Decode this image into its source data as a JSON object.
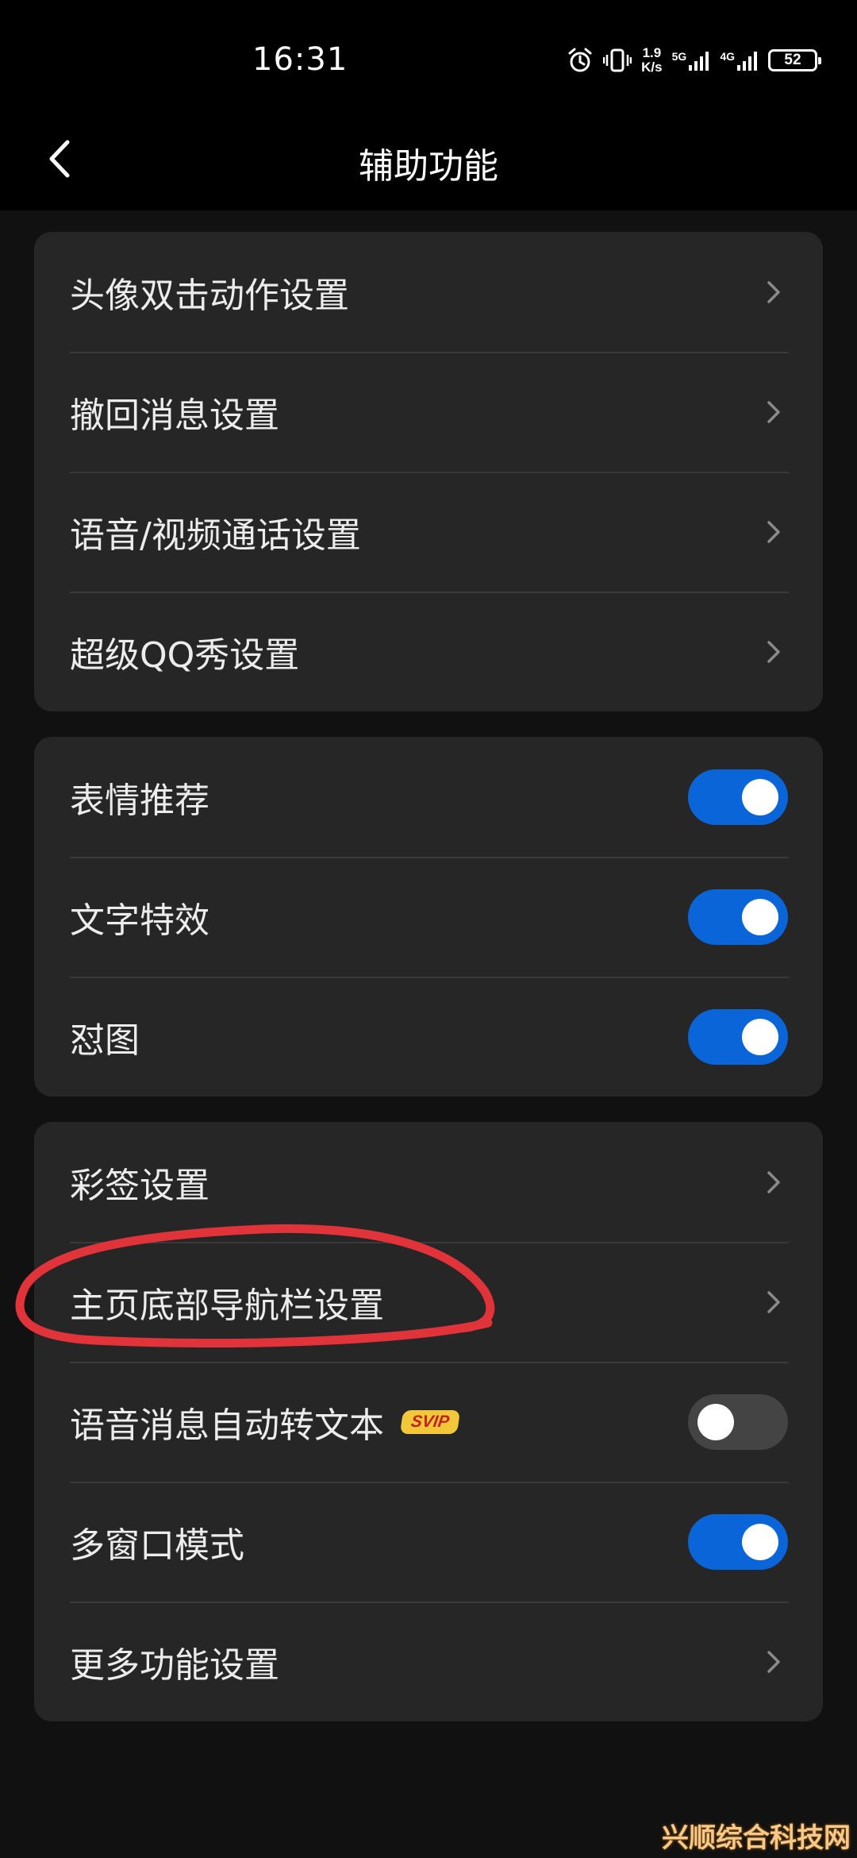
{
  "status_bar": {
    "time": "16:31",
    "net_speed_value": "1.9",
    "net_speed_unit": "K/s",
    "net1": "5G",
    "net2": "4G",
    "battery": "52",
    "icons": [
      "alarm-icon",
      "vibrate-icon",
      "signal-icon",
      "battery-icon"
    ]
  },
  "header": {
    "title": "辅助功能",
    "back_icon": "chevron-left-icon"
  },
  "sections": [
    {
      "rows": [
        {
          "label": "头像双击动作设置",
          "type": "link"
        },
        {
          "label": "撤回消息设置",
          "type": "link"
        },
        {
          "label": "语音/视频通话设置",
          "type": "link"
        },
        {
          "label": "超级QQ秀设置",
          "type": "link"
        }
      ]
    },
    {
      "rows": [
        {
          "label": "表情推荐",
          "type": "toggle",
          "on": true
        },
        {
          "label": "文字特效",
          "type": "toggle",
          "on": true
        },
        {
          "label": "怼图",
          "type": "toggle",
          "on": true
        }
      ]
    },
    {
      "rows": [
        {
          "label": "彩签设置",
          "type": "link"
        },
        {
          "label": "主页底部导航栏设置",
          "type": "link"
        },
        {
          "label": "语音消息自动转文本",
          "type": "toggle",
          "on": false,
          "badge": "SVIP"
        },
        {
          "label": "多窗口模式",
          "type": "toggle",
          "on": true
        },
        {
          "label": "更多功能设置",
          "type": "link"
        }
      ]
    }
  ],
  "watermark": "兴顺综合科技网",
  "colors": {
    "background": "#111111",
    "card": "#262626",
    "toggle_on": "#0a66d8",
    "toggle_off": "#444444",
    "annotation": "#e0333a",
    "badge": "#f2c73a"
  }
}
